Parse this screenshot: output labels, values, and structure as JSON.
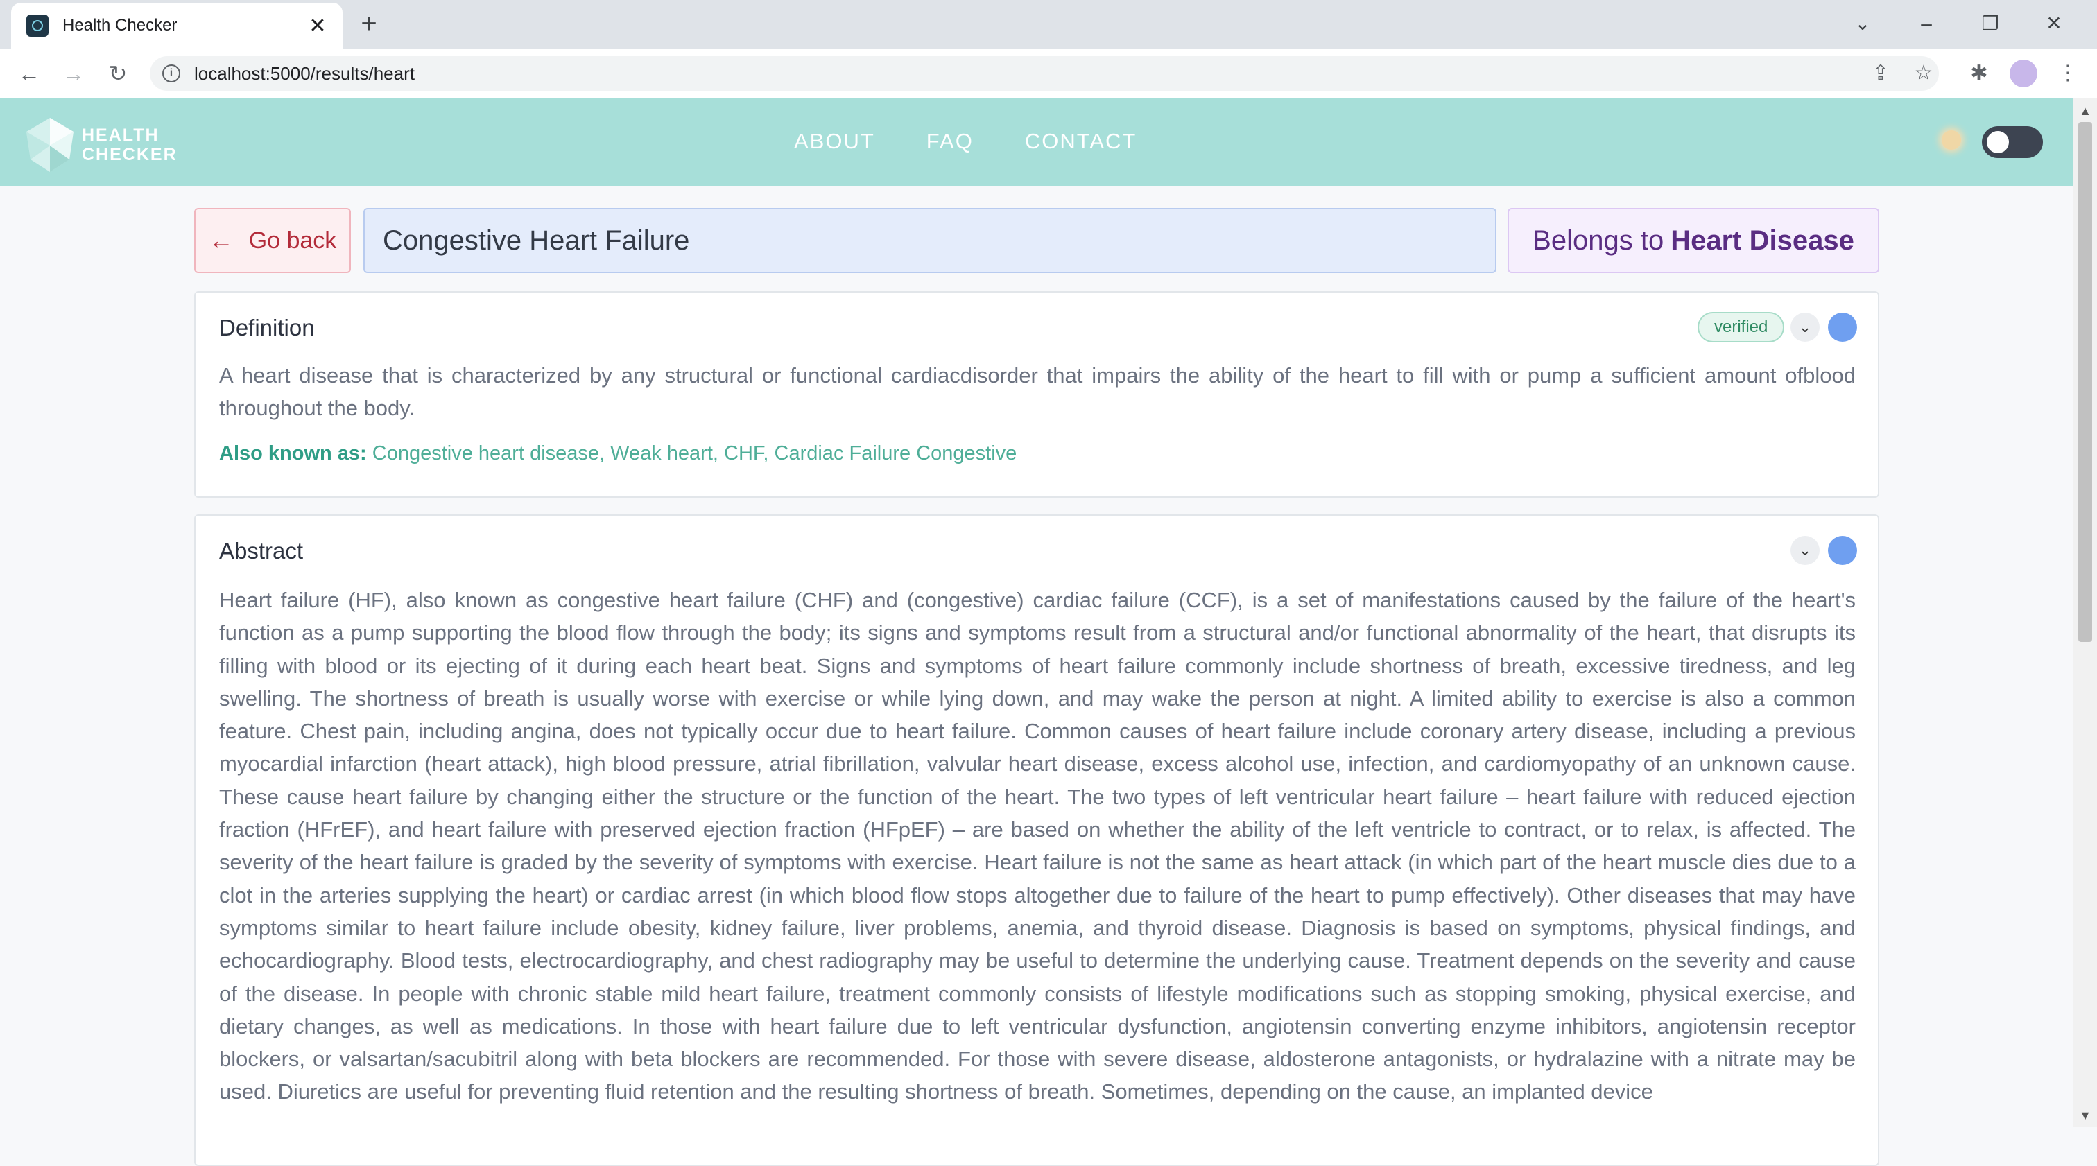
{
  "browser": {
    "tab_title": "Health Checker",
    "url": "localhost:5000/results/heart",
    "new_tab_symbol": "+",
    "close_symbol": "✕"
  },
  "header": {
    "logo_line1": "HEALTH",
    "logo_line2": "CHECKER",
    "nav": [
      "ABOUT",
      "FAQ",
      "CONTACT"
    ],
    "theme_toggle": "off"
  },
  "title_row": {
    "back_arrow": "←",
    "back_label": "Go back",
    "term": "Congestive Heart Failure",
    "belongs_prefix": "Belongs to",
    "belongs_category": "Heart Disease"
  },
  "definition": {
    "title": "Definition",
    "badge": "verified",
    "text": "A heart disease that is characterized by any structural or functional cardiacdisorder that impairs the ability of the heart to fill with or pump a sufficient amount ofblood throughout the body.",
    "aka_label": "Also known as:",
    "aka_value": "Congestive heart disease, Weak heart, CHF, Cardiac Failure Congestive"
  },
  "abstract": {
    "title": "Abstract",
    "text": "Heart failure (HF), also known as congestive heart failure (CHF) and (congestive) cardiac failure (CCF), is a set of manifestations caused by the failure of the heart's function as a pump supporting the blood flow through the body; its signs and symptoms result from a structural and/or functional abnormality of the heart, that disrupts its filling with blood or its ejecting of it during each heart beat. Signs and symptoms of heart failure commonly include shortness of breath, excessive tiredness, and leg swelling. The shortness of breath is usually worse with exercise or while lying down, and may wake the person at night. A limited ability to exercise is also a common feature. Chest pain, including angina, does not typically occur due to heart failure. Common causes of heart failure include coronary artery disease, including a previous myocardial infarction (heart attack), high blood pressure, atrial fibrillation, valvular heart disease, excess alcohol use, infection, and cardiomyopathy of an unknown cause. These cause heart failure by changing either the structure or the function of the heart. The two types of left ventricular heart failure – heart failure with reduced ejection fraction (HFrEF), and heart failure with preserved ejection fraction (HFpEF) – are based on whether the ability of the left ventricle to contract, or to relax, is affected. The severity of the heart failure is graded by the severity of symptoms with exercise. Heart failure is not the same as heart attack (in which part of the heart muscle dies due to a clot in the arteries supplying the heart) or cardiac arrest (in which blood flow stops altogether due to failure of the heart to pump effectively). Other diseases that may have symptoms similar to heart failure include obesity, kidney failure, liver problems, anemia, and thyroid disease. Diagnosis is based on symptoms, physical findings, and echocardiography. Blood tests, electrocardiography, and chest radiography may be useful to determine the underlying cause. Treatment depends on the severity and cause of the disease. In people with chronic stable mild heart failure, treatment commonly consists of lifestyle modifications such as stopping smoking, physical exercise, and dietary changes, as well as medications. In those with heart failure due to left ventricular dysfunction, angiotensin converting enzyme inhibitors, angiotensin receptor blockers, or valsartan/sacubitril along with beta blockers are recommended. For those with severe disease, aldosterone antagonists, or hydralazine with a nitrate may be used. Diuretics are useful for preventing fluid retention and the resulting shortness of breath. Sometimes, depending on the cause, an implanted device"
  },
  "colors": {
    "header_bg": "#a7dfd9",
    "back_accent": "#b32b3a",
    "term_bg": "#e4ecfb",
    "belongs_accent": "#5a2d82",
    "verified": "#2e8a62",
    "aka_accent": "#2f9d86",
    "dot": "#6f9ff0"
  }
}
